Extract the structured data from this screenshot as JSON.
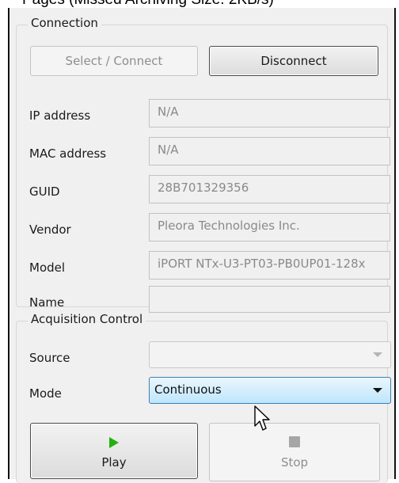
{
  "window_caption": "Pages (Missed Archiving Size: 2KB/s)",
  "connection": {
    "title": "Connection",
    "select_connect_label": "Select / Connect",
    "disconnect_label": "Disconnect",
    "fields": [
      {
        "label": "IP address",
        "value": "N/A"
      },
      {
        "label": "MAC address",
        "value": "N/A"
      },
      {
        "label": "GUID",
        "value": "28B701329356"
      },
      {
        "label": "Vendor",
        "value": "Pleora Technologies Inc."
      },
      {
        "label": "Model",
        "value": "iPORT NTx-U3-PT03-PB0UP01-128x"
      },
      {
        "label": "Name",
        "value": ""
      }
    ]
  },
  "acquisition": {
    "title": "Acquisition Control",
    "source_label": "Source",
    "source_value": "",
    "mode_label": "Mode",
    "mode_value": "Continuous",
    "play_label": "Play",
    "stop_label": "Stop"
  },
  "colors": {
    "play_icon": "#22b00f",
    "stop_icon": "#a6a6a6",
    "combo_highlight": "#bee6fd"
  }
}
